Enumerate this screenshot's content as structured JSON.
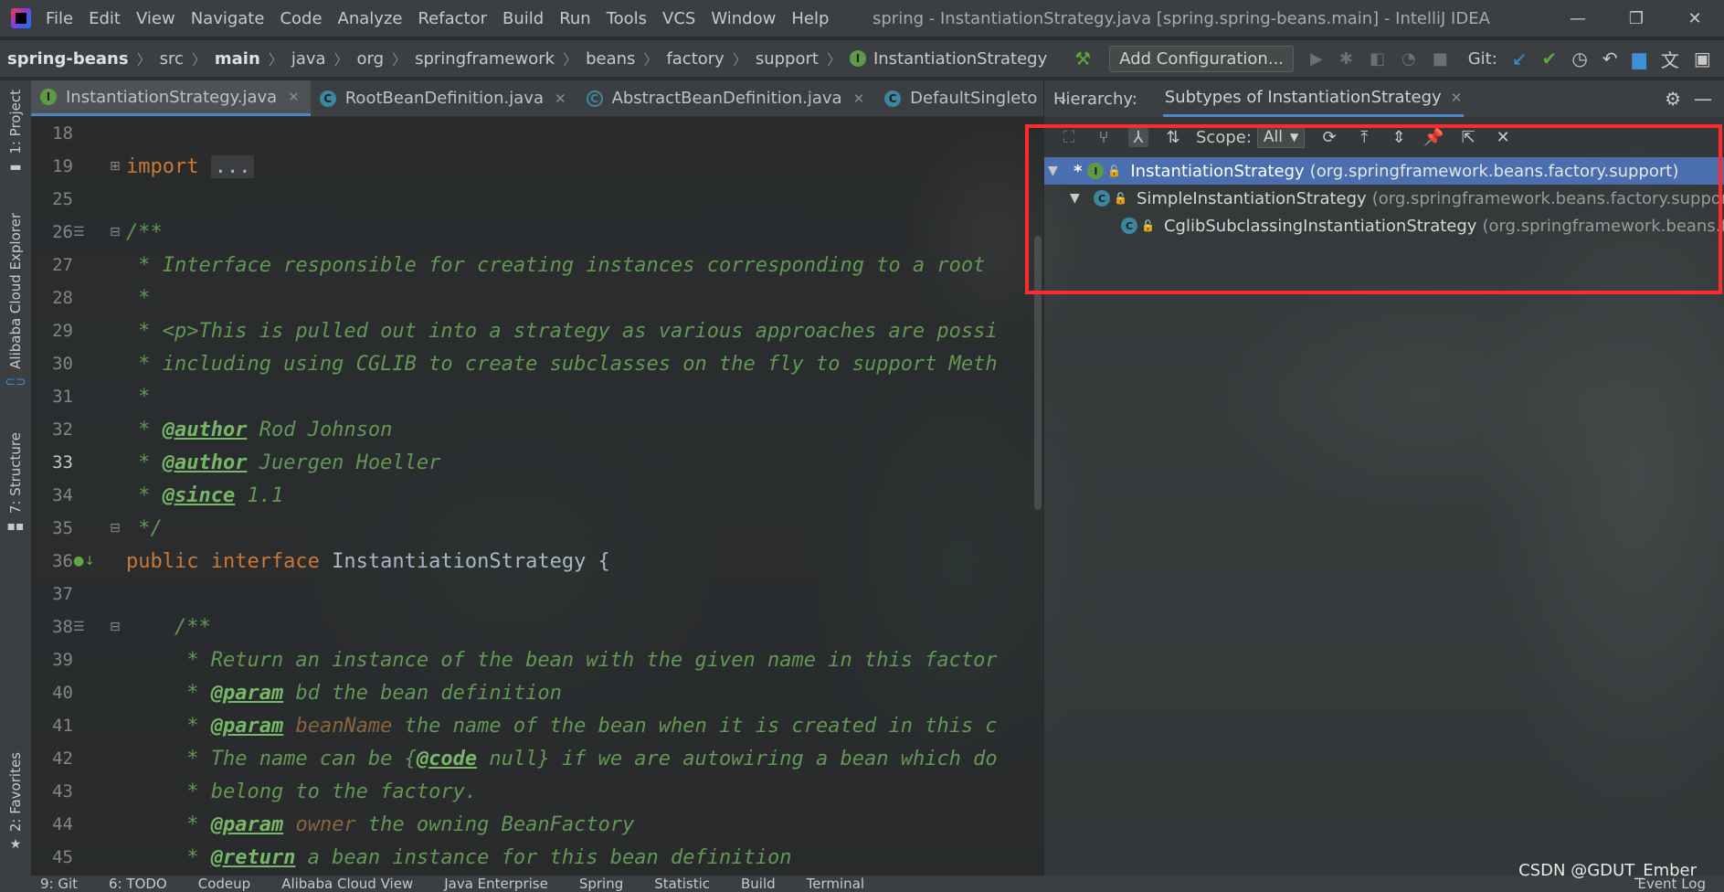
{
  "menubar": {
    "items": [
      "File",
      "Edit",
      "View",
      "Navigate",
      "Code",
      "Analyze",
      "Refactor",
      "Build",
      "Run",
      "Tools",
      "VCS",
      "Window",
      "Help"
    ],
    "window_title": "spring - InstantiationStrategy.java [spring.spring-beans.main] - IntelliJ IDEA",
    "controls": [
      "—",
      "❐",
      "✕"
    ]
  },
  "navbar": {
    "breadcrumbs": [
      "spring-beans",
      "src",
      "main",
      "java",
      "org",
      "springframework",
      "beans",
      "factory",
      "support",
      "InstantiationStrategy"
    ],
    "add_config": "Add Configuration...",
    "git_label": "Git:"
  },
  "left_strip": {
    "tabs": [
      "1: Project",
      "Alibaba Cloud Explorer",
      "7: Structure",
      "2: Favorites"
    ]
  },
  "editor_tabs": [
    {
      "label": "InstantiationStrategy.java",
      "badge": "I",
      "kind": "i",
      "active": true
    },
    {
      "label": "RootBeanDefinition.java",
      "badge": "C",
      "kind": "c",
      "active": false
    },
    {
      "label": "AbstractBeanDefinition.java",
      "badge": "C",
      "kind": "ca",
      "active": false
    },
    {
      "label": "DefaultSingleto",
      "badge": "C",
      "kind": "c",
      "active": false
    }
  ],
  "editor": {
    "lines": [
      {
        "n": "18",
        "text": ""
      },
      {
        "n": "19",
        "text": "import ..."
      },
      {
        "n": "25",
        "text": ""
      },
      {
        "n": "26",
        "text": "/**"
      },
      {
        "n": "27",
        "text": " * Interface responsible for creating instances corresponding to a root"
      },
      {
        "n": "28",
        "text": " *"
      },
      {
        "n": "29",
        "text": " * <p>This is pulled out into a strategy as various approaches are possi"
      },
      {
        "n": "30",
        "text": " * including using CGLIB to create subclasses on the fly to support Meth"
      },
      {
        "n": "31",
        "text": " *"
      },
      {
        "n": "32",
        "text": " * @author Rod Johnson"
      },
      {
        "n": "33",
        "text": " * @author Juergen Hoeller"
      },
      {
        "n": "34",
        "text": " * @since 1.1"
      },
      {
        "n": "35",
        "text": " */"
      },
      {
        "n": "36",
        "text": "public interface InstantiationStrategy {"
      },
      {
        "n": "37",
        "text": ""
      },
      {
        "n": "38",
        "text": "    /**"
      },
      {
        "n": "39",
        "text": "     * Return an instance of the bean with the given name in this factor"
      },
      {
        "n": "40",
        "text": "     * @param bd the bean definition"
      },
      {
        "n": "41",
        "text": "     * @param beanName the name of the bean when it is created in this c"
      },
      {
        "n": "42",
        "text": "     * The name can be {@code null} if we are autowiring a bean which do"
      },
      {
        "n": "43",
        "text": "     * belong to the factory."
      },
      {
        "n": "44",
        "text": "     * @param owner the owning BeanFactory"
      },
      {
        "n": "45",
        "text": "     * @return a bean instance for this bean definition"
      }
    ]
  },
  "hierarchy": {
    "title": "Hierarchy:",
    "tab": "Subtypes of InstantiationStrategy",
    "scope_label": "Scope:",
    "scope_value": "All",
    "nodes": [
      {
        "name": "InstantiationStrategy",
        "pkg": "(org.springframework.beans.factory.support)",
        "kind": "I"
      },
      {
        "name": "SimpleInstantiationStrategy",
        "pkg": "(org.springframework.beans.factory.support)",
        "kind": "C"
      },
      {
        "name": "CglibSubclassingInstantiationStrategy",
        "pkg": "(org.springframework.beans.fac",
        "kind": "C"
      }
    ]
  },
  "bottombar": {
    "items": [
      "9: Git",
      "6: TODO",
      "Codeup",
      "Alibaba Cloud View",
      "Java Enterprise",
      "Spring",
      "Statistic",
      "Build",
      "Terminal",
      "Event Log"
    ]
  },
  "watermark": "CSDN @GDUT_Ember",
  "colors": {
    "accent": "#4a88c7",
    "selection": "#4b6eaf",
    "highlight": "#ff2a2a",
    "keyword": "#cc7832",
    "comment": "#629755"
  }
}
